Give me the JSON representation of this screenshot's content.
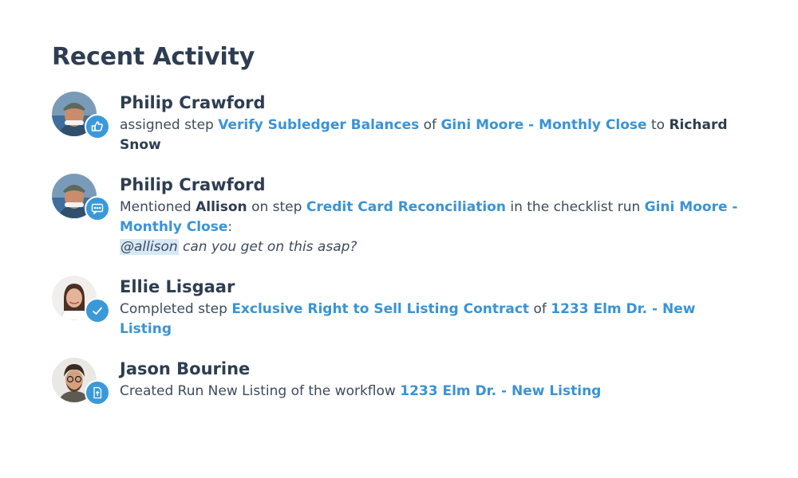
{
  "page_title": "Recent Activity",
  "activities": [
    {
      "user": "Philip Crawford",
      "badge_icon": "thumbs-up-icon",
      "action": "assigned step",
      "step": "Verify Subledger Balances",
      "connector": "of",
      "run": "Gini Moore - Monthly Close",
      "to_word": "to",
      "assignee": "Richard Snow"
    },
    {
      "user": "Philip Crawford",
      "badge_icon": "comment-icon",
      "action": "Mentioned",
      "mentioned_user": "Allison",
      "on_step": "on step",
      "step": "Credit Card Reconciliation",
      "in_run": "in the checklist run",
      "run": "Gini Moore - Monthly Close",
      "colon": ":",
      "mention_tag": "@allison",
      "comment_text": "can you get on this asap",
      "comment_end": "?"
    },
    {
      "user": "Ellie Lisgaar",
      "badge_icon": "checkmark-icon",
      "action": "Completed step",
      "step": "Exclusive Right to Sell Listing Contract",
      "connector": "of",
      "run": "1233 Elm Dr. - New Listing"
    },
    {
      "user": "Jason Bourine",
      "badge_icon": "document-upload-icon",
      "action": "Created Run New Listing of the workflow",
      "run": "1233 Elm Dr. - New Listing"
    }
  ],
  "colors": {
    "link": "#3a93d6",
    "badge": "#3a99d9",
    "heading": "#2e3d51",
    "text": "#3d4b5c",
    "mention_highlight": "#d8e8f6"
  }
}
